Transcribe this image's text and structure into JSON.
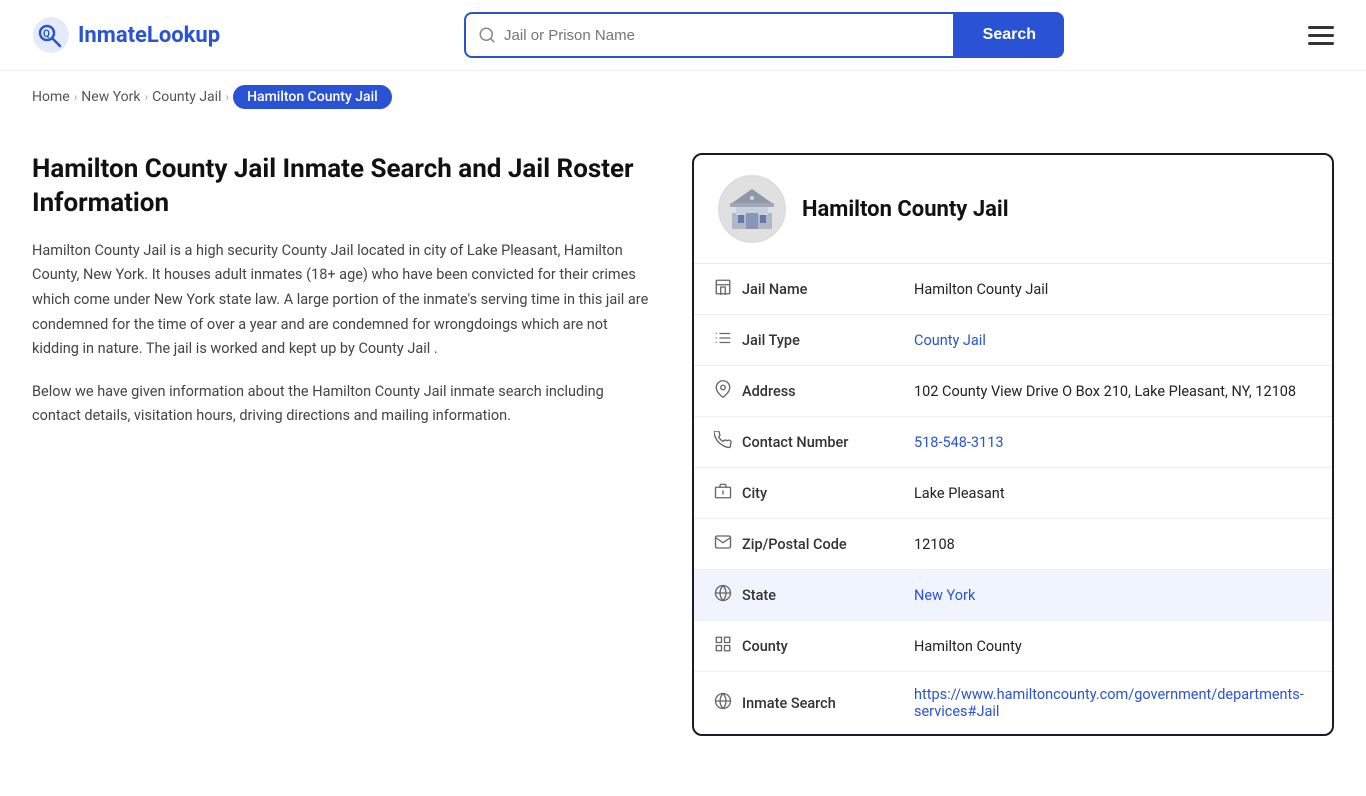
{
  "header": {
    "logo_text": "InmateLookup",
    "search_placeholder": "Jail or Prison Name",
    "search_button_label": "Search"
  },
  "breadcrumb": {
    "home": "Home",
    "state": "New York",
    "section": "County Jail",
    "current": "Hamilton County Jail"
  },
  "left": {
    "title": "Hamilton County Jail Inmate Search and Jail Roster Information",
    "description1": "Hamilton County Jail is a high security County Jail located in city of Lake Pleasant, Hamilton County, New York. It houses adult inmates (18+ age) who have been convicted for their crimes which come under New York state law. A large portion of the inmate's serving time in this jail are condemned for the time of over a year and are condemned for wrongdoings which are not kidding in nature. The jail is worked and kept up by County Jail .",
    "description2": "Below we have given information about the Hamilton County Jail inmate search including contact details, visitation hours, driving directions and mailing information."
  },
  "card": {
    "jail_name": "Hamilton County Jail",
    "fields": [
      {
        "id": "jail-name",
        "label": "Jail Name",
        "value": "Hamilton County Jail",
        "link": null,
        "highlighted": false,
        "icon": "building"
      },
      {
        "id": "jail-type",
        "label": "Jail Type",
        "value": "County Jail",
        "link": "#",
        "highlighted": false,
        "icon": "list"
      },
      {
        "id": "address",
        "label": "Address",
        "value": "102 County View Drive O Box 210, Lake Pleasant, NY, 12108",
        "link": null,
        "highlighted": false,
        "icon": "location"
      },
      {
        "id": "contact",
        "label": "Contact Number",
        "value": "518-548-3113",
        "link": "tel:518-548-3113",
        "highlighted": false,
        "icon": "phone"
      },
      {
        "id": "city",
        "label": "City",
        "value": "Lake Pleasant",
        "link": null,
        "highlighted": false,
        "icon": "city"
      },
      {
        "id": "zip",
        "label": "Zip/Postal Code",
        "value": "12108",
        "link": null,
        "highlighted": false,
        "icon": "envelope"
      },
      {
        "id": "state",
        "label": "State",
        "value": "New York",
        "link": "#",
        "highlighted": true,
        "icon": "globe"
      },
      {
        "id": "county",
        "label": "County",
        "value": "Hamilton County",
        "link": null,
        "highlighted": false,
        "icon": "county"
      },
      {
        "id": "inmate-search",
        "label": "Inmate Search",
        "value": "https://www.hamiltoncounty.com/government/departments-services#Jail",
        "link": "https://www.hamiltoncounty.com/government/departments-services#Jail",
        "highlighted": false,
        "icon": "globe2"
      }
    ]
  }
}
